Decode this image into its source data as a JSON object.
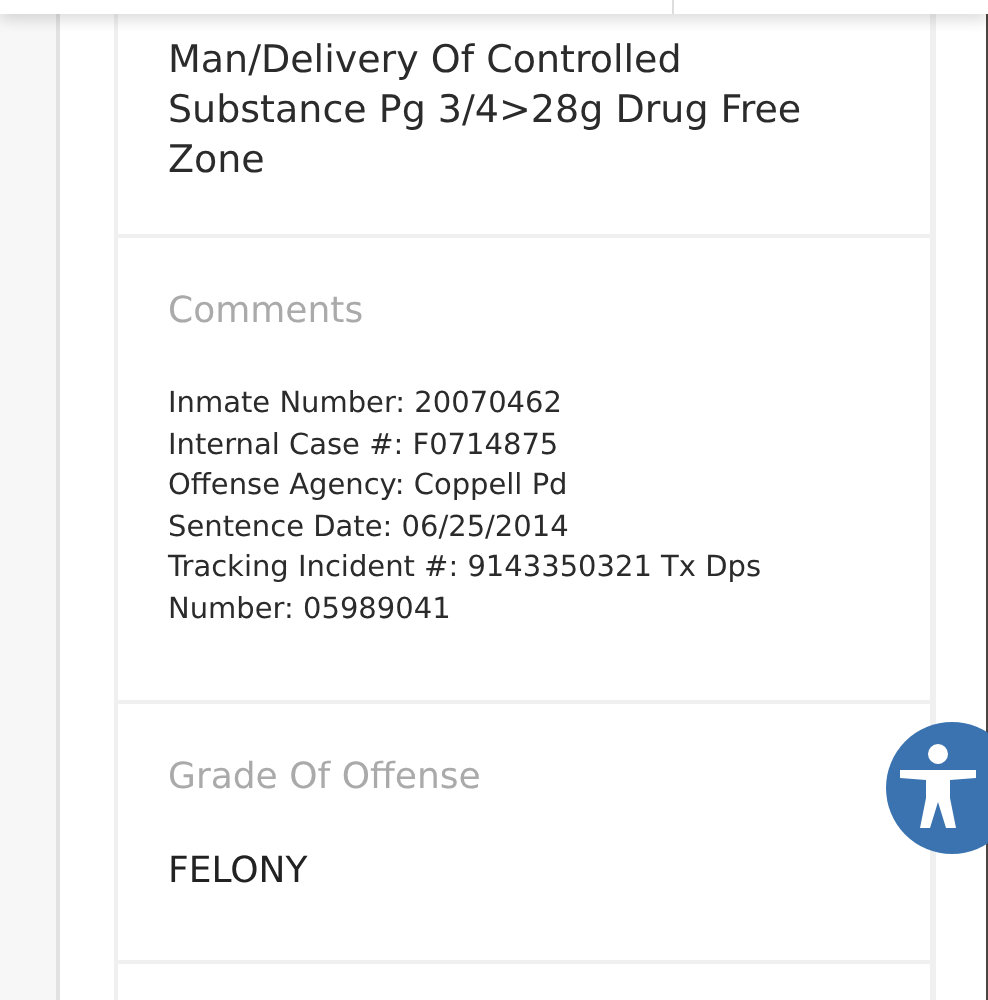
{
  "sections": [
    {
      "kind": "value",
      "value": "Man/Delivery Of Controlled Substance Pg 3/4>28g Drug Free Zone"
    },
    {
      "kind": "lines",
      "label": "Comments",
      "lines": [
        "Inmate Number: 20070462",
        "Internal Case #: F0714875",
        "Offense Agency: Coppell Pd",
        "Sentence Date: 06/25/2014",
        "Tracking Incident #: 9143350321 Tx Dps",
        "Number: 05989041"
      ]
    },
    {
      "kind": "labeled",
      "label": "Grade Of Offense",
      "value": "FELONY"
    }
  ]
}
